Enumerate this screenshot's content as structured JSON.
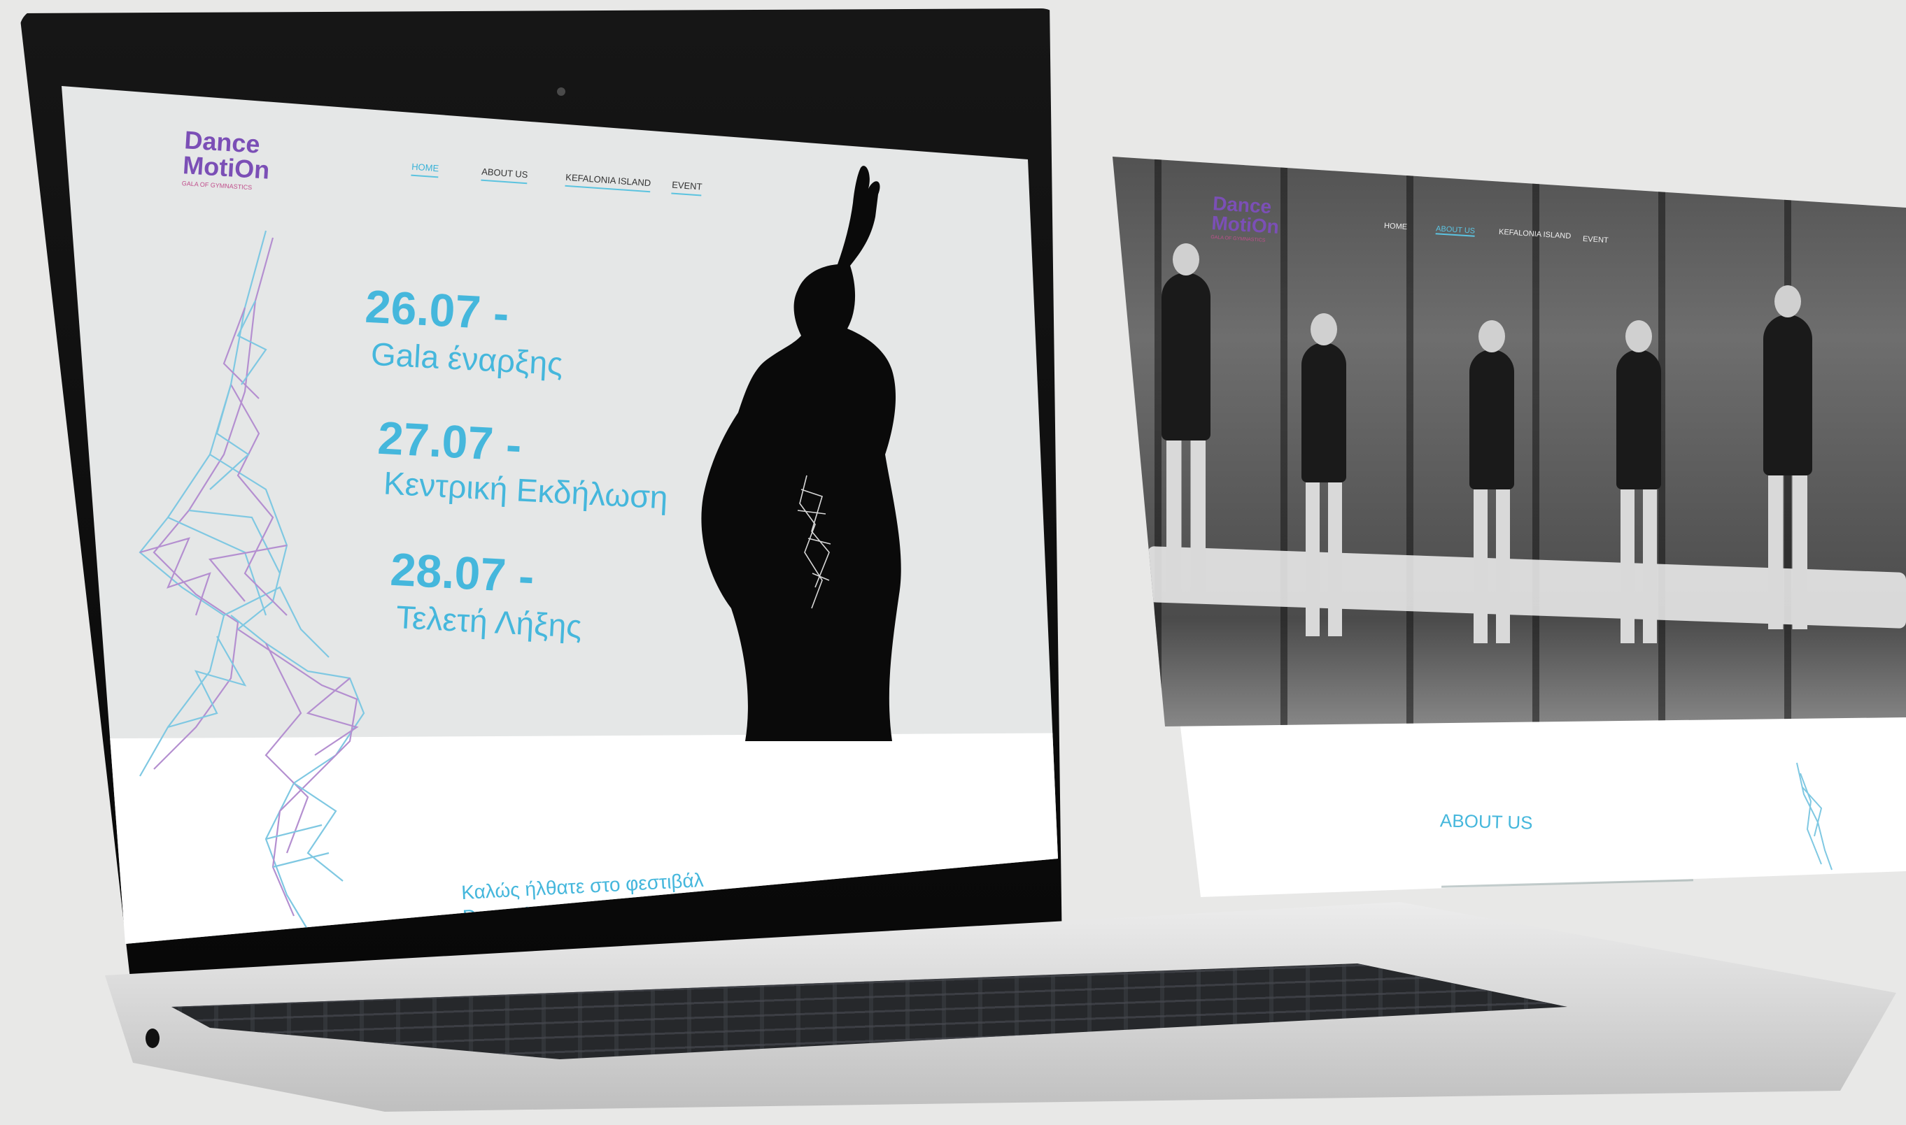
{
  "laptop_site": {
    "logo": {
      "line1": "Dance",
      "line2": "MotiOn",
      "tagline": "GALA OF GYMNASTICS"
    },
    "nav": [
      "HOME",
      "ABOUT US",
      "KEFALONIA ISLAND",
      "EVENT"
    ],
    "active_nav": "HOME",
    "events": [
      {
        "date": "26.07 -",
        "name": "Gala έναρξης"
      },
      {
        "date": "27.07 -",
        "name": "Κεντρική Εκδήλωση"
      },
      {
        "date": "28.07 -",
        "name": "Τελετή Λήξης"
      }
    ],
    "welcome": {
      "line1": "Καλώς ήλθατε στο φεστιβάλ",
      "line2": "Dance Motion Gym!"
    }
  },
  "panel_site": {
    "logo": {
      "line1": "Dance",
      "line2": "MotiOn",
      "tagline": "GALA OF GYMNASTICS"
    },
    "nav": [
      "HOME",
      "ABOUT US",
      "KEFALONIA ISLAND",
      "EVENT"
    ],
    "active_nav": "ABOUT US",
    "section_title": "ABOUT US"
  },
  "colors": {
    "accent": "#45b7dc",
    "logo_purple": "#7b4fb6",
    "logo_pink": "#c04f8c",
    "screen_bg": "#e5e7e7",
    "page_bg": "#e8e8e7"
  }
}
